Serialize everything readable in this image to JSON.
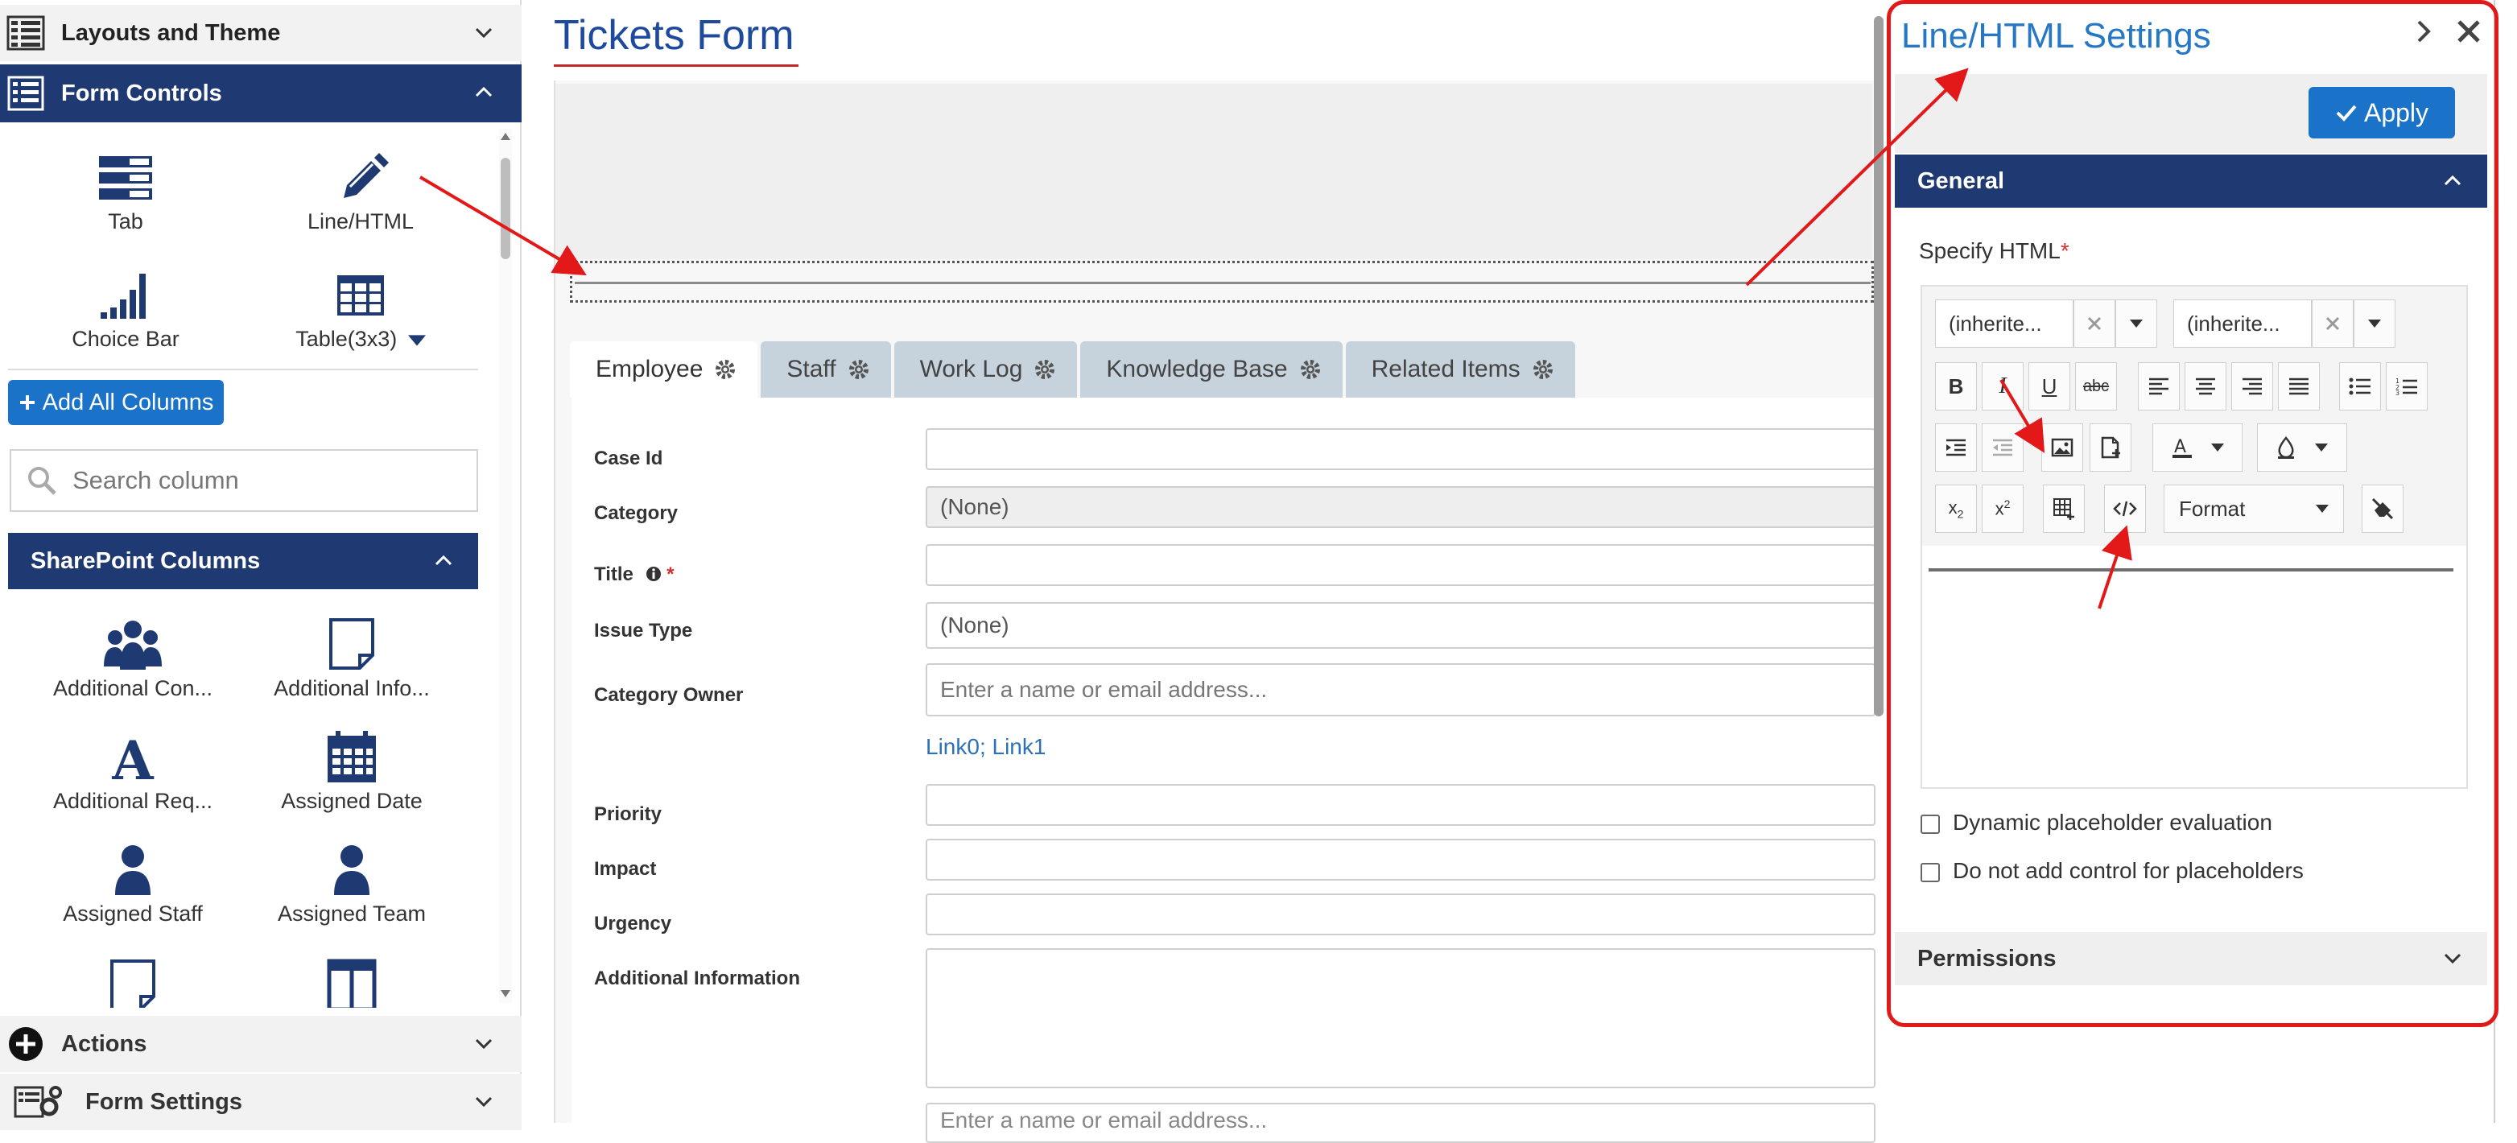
{
  "left_panel": {
    "layouts_header": "Layouts and Theme",
    "form_controls_header": "Form Controls",
    "controls": [
      {
        "label": "Tab",
        "icon": "tab-icon"
      },
      {
        "label": "Line/HTML",
        "icon": "pencil-icon"
      },
      {
        "label": "Choice Bar",
        "icon": "signal-bars-icon"
      },
      {
        "label": "Table(3x3)",
        "icon": "table-grid-icon"
      }
    ],
    "add_all_label": "Add All Columns",
    "search_placeholder": "Search column",
    "sharepoint_header": "SharePoint Columns",
    "columns": [
      {
        "label": "Additional Con...",
        "icon": "users-group-icon"
      },
      {
        "label": "Additional Info...",
        "icon": "note-icon"
      },
      {
        "label": "Additional Req...",
        "icon": "letter-a-icon"
      },
      {
        "label": "Assigned Date",
        "icon": "calendar-icon"
      },
      {
        "label": "Assigned Staff",
        "icon": "user-icon"
      },
      {
        "label": "Assigned Team",
        "icon": "user-icon"
      },
      {
        "label": "",
        "icon": "note-icon"
      },
      {
        "label": "",
        "icon": "columns-icon"
      }
    ],
    "actions_header": "Actions",
    "form_settings_header": "Form Settings"
  },
  "form": {
    "title": "Tickets Form",
    "tabs": [
      "Employee",
      "Staff",
      "Work Log",
      "Knowledge Base",
      "Related Items"
    ],
    "fields": [
      {
        "label": "Case Id",
        "value": ""
      },
      {
        "label": "Category",
        "value": "(None)"
      },
      {
        "label": "Title",
        "value": ""
      },
      {
        "label": "Issue Type",
        "value": "(None)"
      },
      {
        "label": "Category Owner",
        "value": ""
      },
      {
        "label": "Priority",
        "value": ""
      },
      {
        "label": "Impact",
        "value": ""
      },
      {
        "label": "Urgency",
        "value": ""
      },
      {
        "label": "Additional Information",
        "value": ""
      }
    ],
    "people_placeholder": "Enter a name or email address...",
    "link_text": "Link0; Link1",
    "required_mark": "*"
  },
  "settings": {
    "title": "Line/HTML Settings",
    "apply_label": "Apply",
    "general_header": "General",
    "specify_html_label": "Specify HTML",
    "required_mark": "*",
    "font_family_value": "(inherite...",
    "font_size_value": "(inherite...",
    "format_label": "Format",
    "dynamic_placeholder_label": "Dynamic placeholder evaluation",
    "no_control_placeholder_label": "Do not add control for placeholders",
    "permissions_header": "Permissions"
  },
  "colors": {
    "header_navy": "#1f3a73",
    "accent_blue": "#1a73c9",
    "title_blue": "#1d4a9e",
    "annotation_red": "#e31919"
  }
}
